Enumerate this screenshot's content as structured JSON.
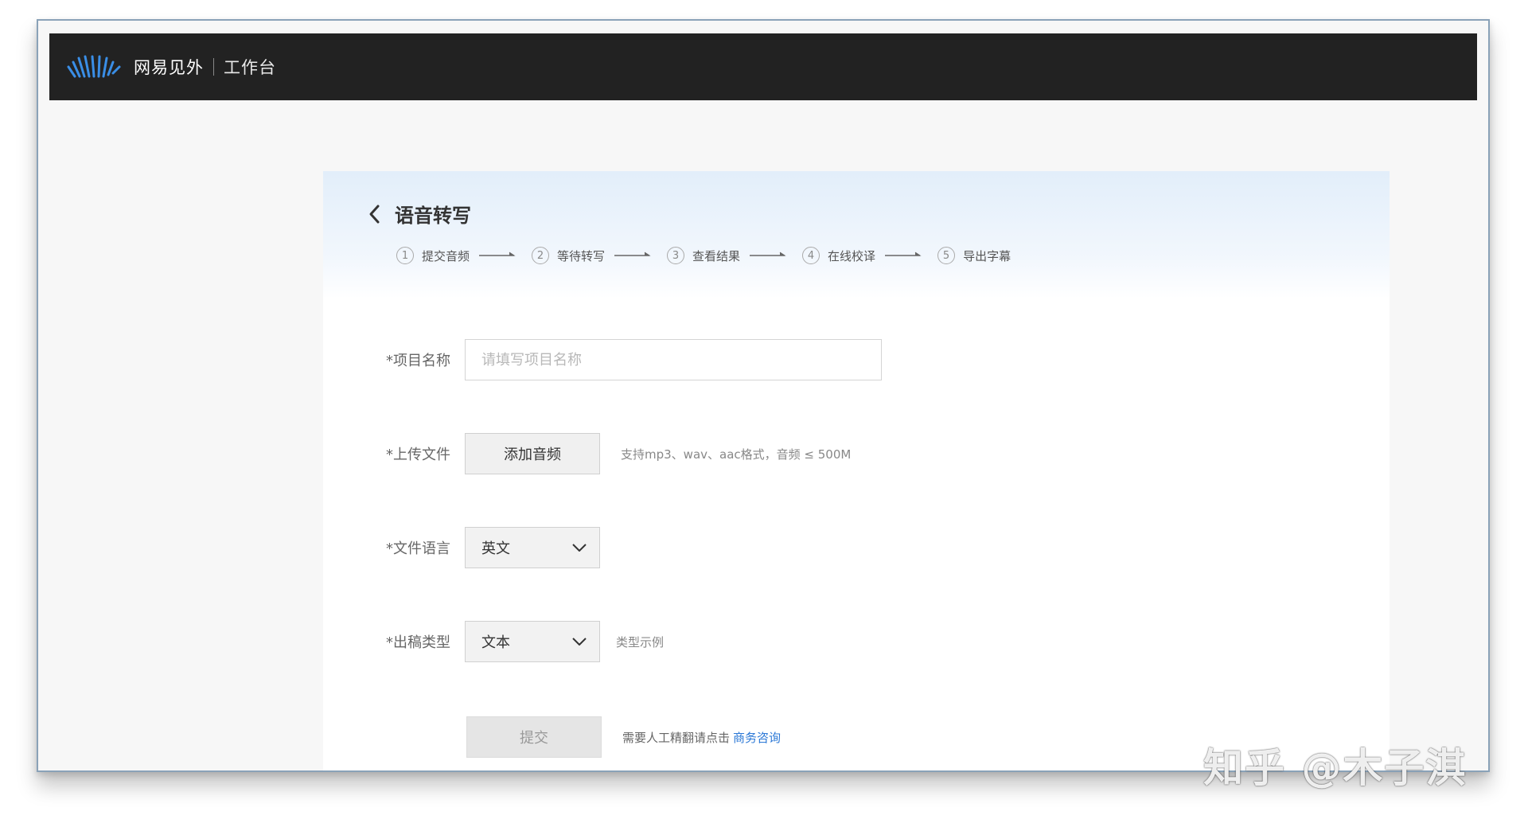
{
  "app": {
    "brand": "网易见外",
    "section": "工作台"
  },
  "page": {
    "title": "语音转写",
    "steps": [
      {
        "num": "1",
        "label": "提交音频"
      },
      {
        "num": "2",
        "label": "等待转写"
      },
      {
        "num": "3",
        "label": "查看结果"
      },
      {
        "num": "4",
        "label": "在线校译"
      },
      {
        "num": "5",
        "label": "导出字幕"
      }
    ]
  },
  "form": {
    "project_name": {
      "label": "*项目名称",
      "placeholder": "请填写项目名称",
      "value": ""
    },
    "upload": {
      "label": "*上传文件",
      "button": "添加音频",
      "hint": "支持mp3、wav、aac格式，音频 ≤ 500M"
    },
    "language": {
      "label": "*文件语言",
      "value": "英文"
    },
    "output_type": {
      "label": "*出稿类型",
      "value": "文本",
      "hint": "类型示例"
    },
    "submit": {
      "button": "提交",
      "note": "需要人工精翻请点击",
      "link": "商务咨询"
    }
  },
  "watermark": "知乎 @木子淇",
  "colors": {
    "topbar": "#222222",
    "link": "#2b78d6",
    "logo_blue": "#3a8ee6"
  }
}
